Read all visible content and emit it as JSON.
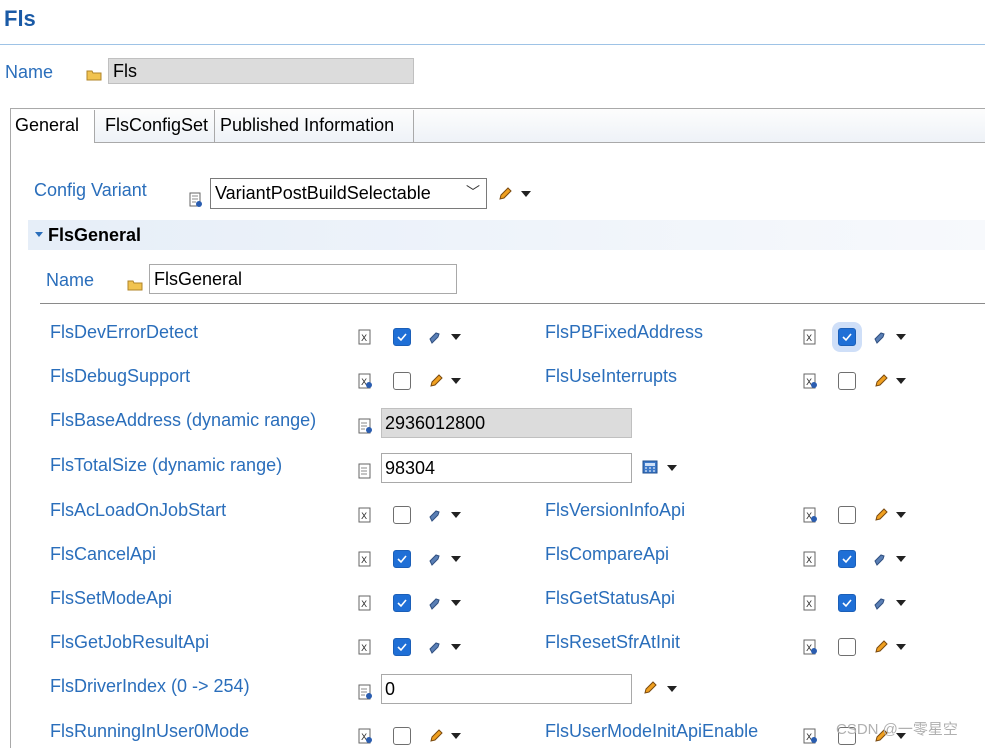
{
  "header": {
    "title": "Fls"
  },
  "top": {
    "name_label": "Name",
    "name_value": "Fls"
  },
  "tabs": [
    {
      "label": "General"
    },
    {
      "label": "FlsConfigSet"
    },
    {
      "label": "Published Information"
    }
  ],
  "config_variant": {
    "label": "Config Variant",
    "value": "VariantPostBuildSelectable"
  },
  "section": {
    "title": "FlsGeneral",
    "name_label": "Name",
    "name_value": "FlsGeneral"
  },
  "params": {
    "dev_error_detect": {
      "label": "FlsDevErrorDetect",
      "checked": true
    },
    "pb_fixed_address": {
      "label": "FlsPBFixedAddress",
      "checked": true
    },
    "debug_support": {
      "label": "FlsDebugSupport",
      "checked": false
    },
    "use_interrupts": {
      "label": "FlsUseInterrupts",
      "checked": false
    },
    "base_address": {
      "label": "FlsBaseAddress (dynamic range)",
      "value": "2936012800"
    },
    "total_size": {
      "label": "FlsTotalSize (dynamic range)",
      "value": "98304"
    },
    "ac_load_on_job_start": {
      "label": "FlsAcLoadOnJobStart",
      "checked": false
    },
    "version_info_api": {
      "label": "FlsVersionInfoApi",
      "checked": false
    },
    "cancel_api": {
      "label": "FlsCancelApi",
      "checked": true
    },
    "compare_api": {
      "label": "FlsCompareApi",
      "checked": true
    },
    "set_mode_api": {
      "label": "FlsSetModeApi",
      "checked": true
    },
    "get_status_api": {
      "label": "FlsGetStatusApi",
      "checked": true
    },
    "get_job_result_api": {
      "label": "FlsGetJobResultApi",
      "checked": true
    },
    "reset_sfr_at_init": {
      "label": "FlsResetSfrAtInit",
      "checked": false
    },
    "driver_index": {
      "label": "FlsDriverIndex (0 -> 254)",
      "value": "0"
    },
    "running_in_user0_mode": {
      "label": "FlsRunningInUser0Mode",
      "checked": false
    },
    "user_mode_init_api_enable": {
      "label": "FlsUserModeInitApiEnable",
      "checked": false
    }
  },
  "watermark": "CSDN @一零星空",
  "colors": {
    "label_blue": "#2a6ebb",
    "check_blue": "#1f6fd6"
  }
}
